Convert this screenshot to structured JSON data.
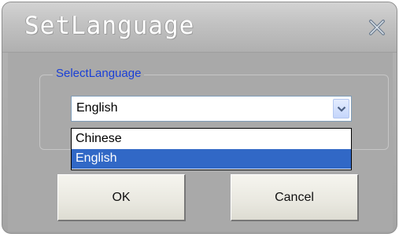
{
  "window": {
    "title": "SetLanguage",
    "close_icon": "close-x-icon"
  },
  "group": {
    "label": "SelectLanguage"
  },
  "combo": {
    "selected": "English",
    "arrow_icon": "chevron-down-icon",
    "options": [
      "Chinese",
      "English"
    ],
    "highlighted_option": "English"
  },
  "buttons": {
    "ok_label": "OK",
    "cancel_label": "Cancel"
  },
  "colors": {
    "title_text": "#ffffff",
    "group_label": "#1a3fd6",
    "selection": "#3168c6",
    "window_bg": "#a9a9a9"
  }
}
